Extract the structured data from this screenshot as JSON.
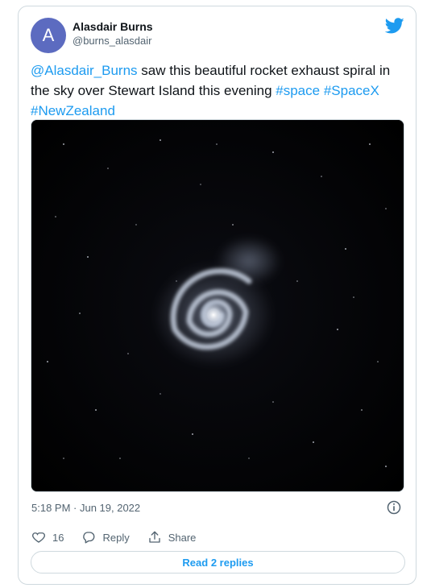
{
  "tweet": {
    "author_name": "Alasdair Burns",
    "author_handle": "@burns_alasdair",
    "avatar_initial": "A",
    "text_parts": {
      "mention": "@Alasdair_Burns",
      "body1": " saw this beautiful rocket exhaust spiral in the sky over Stewart Island this evening ",
      "tag1": "#space",
      "tag2": "#SpaceX",
      "tag3": "#NewZealand"
    },
    "timestamp": "5:18 PM · Jun 19, 2022",
    "likes": "16",
    "reply_label": "Reply",
    "share_label": "Share",
    "read_replies": "Read 2 replies",
    "media_icon": "rocket-exhaust-spiral-photo"
  },
  "colors": {
    "accent": "#1d9bf0",
    "avatar": "#5c6bc0",
    "muted": "#536471"
  }
}
